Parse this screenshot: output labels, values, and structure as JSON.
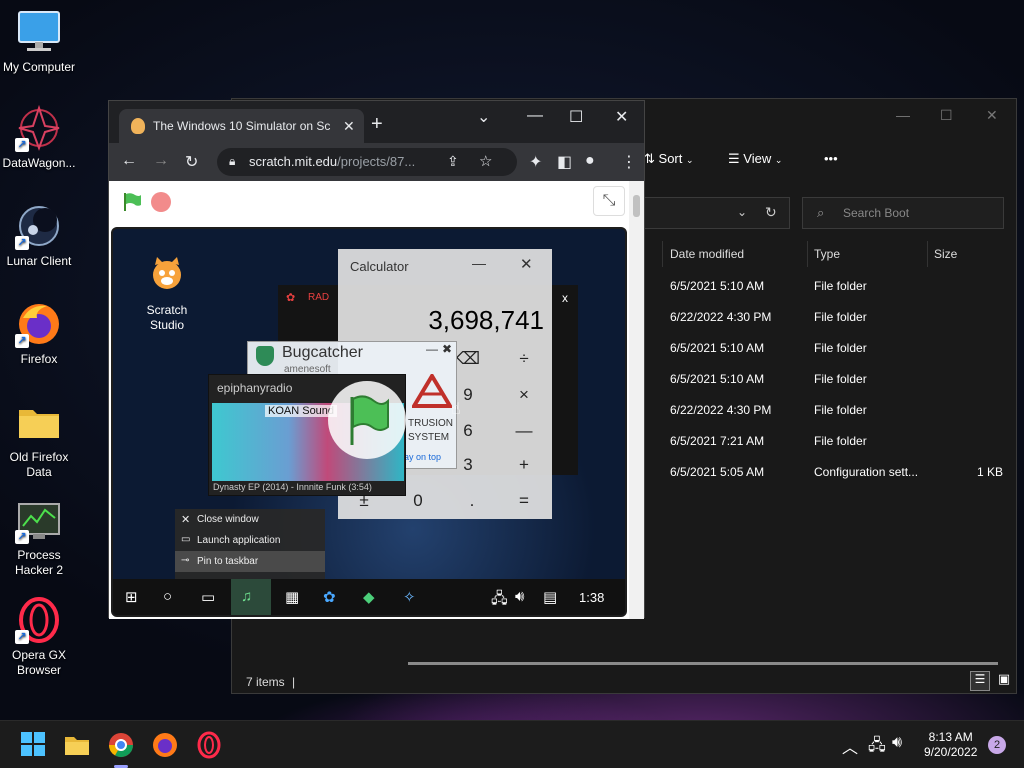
{
  "desktop": {
    "icons": [
      {
        "label": "My Computer",
        "icon": "monitor-icon"
      },
      {
        "label": "DataWagon...",
        "icon": "datawagon-icon"
      },
      {
        "label": "Lunar Client",
        "icon": "lunar-client-icon"
      },
      {
        "label": "Firefox",
        "icon": "firefox-icon"
      },
      {
        "label": "Old Firefox Data",
        "icon": "folder-icon"
      },
      {
        "label": "Process Hacker 2",
        "icon": "process-hacker-icon"
      },
      {
        "label": "Opera GX Browser",
        "icon": "opera-gx-icon"
      }
    ]
  },
  "explorer": {
    "toolbar": {
      "sort_label": "Sort",
      "view_label": "View",
      "more_label": "•••"
    },
    "search_placeholder": "Search Boot",
    "columns": {
      "date": "Date modified",
      "type": "Type",
      "size": "Size"
    },
    "rows": [
      {
        "date": "6/5/2021 5:10 AM",
        "type": "File folder",
        "size": ""
      },
      {
        "date": "6/22/2022 4:30 PM",
        "type": "File folder",
        "size": ""
      },
      {
        "date": "6/5/2021 5:10 AM",
        "type": "File folder",
        "size": ""
      },
      {
        "date": "6/5/2021 5:10 AM",
        "type": "File folder",
        "size": ""
      },
      {
        "date": "6/22/2022 4:30 PM",
        "type": "File folder",
        "size": ""
      },
      {
        "date": "6/5/2021 7:21 AM",
        "type": "File folder",
        "size": ""
      },
      {
        "date": "6/5/2021 5:05 AM",
        "type": "Configuration sett...",
        "size": "1 KB"
      }
    ],
    "status": "7 items"
  },
  "chrome": {
    "tab_title": "The Windows 10 Simulator on Sc",
    "url_host": "scratch.mit.edu",
    "url_path": "/projects/87..."
  },
  "scratch": {
    "desktop_icon_label": "Scratch Studio",
    "calculator": {
      "title": "Calculator",
      "display": "3,698,741",
      "keys": [
        "⌫",
        "÷",
        "9",
        "×",
        "6",
        "—",
        "3",
        "+",
        "±",
        "0",
        ".",
        "="
      ]
    },
    "bugcatcher": {
      "title": "Bugcatcher",
      "subtitle": "amenesoft",
      "line1": "TRUSION",
      "line2": "SYSTEM",
      "link": "ay on top"
    },
    "radio": {
      "title": "epiphanyradio",
      "station": "KOAN Sound",
      "track": "Dynasty EP (2014) - Innnite Funk (3:54)"
    },
    "radar_label": "RAD",
    "context_menu": [
      "Close window",
      "Launch application",
      "Pin to taskbar"
    ],
    "clock": "1:38"
  },
  "taskbar": {
    "time": "8:13 AM",
    "date": "9/20/2022",
    "notifications": "2"
  }
}
